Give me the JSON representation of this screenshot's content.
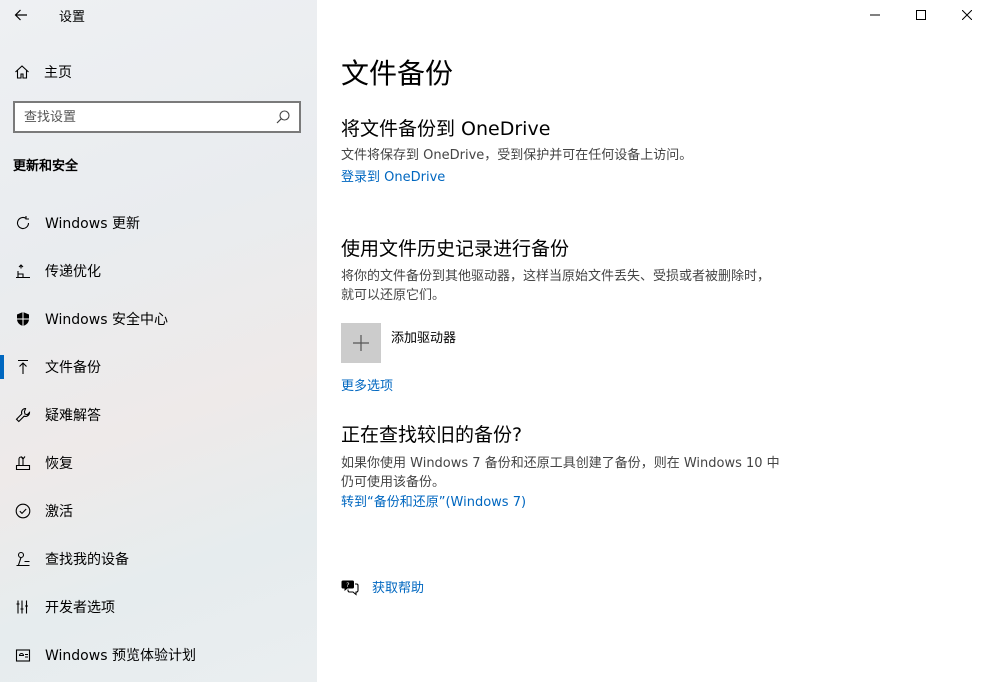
{
  "window": {
    "title": "设置"
  },
  "sidebar": {
    "home_label": "主页",
    "search_placeholder": "查找设置",
    "section_title": "更新和安全",
    "items": [
      {
        "label": "Windows 更新",
        "icon": "refresh-icon"
      },
      {
        "label": "传递优化",
        "icon": "delivery-optimization-icon"
      },
      {
        "label": "Windows 安全中心",
        "icon": "shield-icon"
      },
      {
        "label": "文件备份",
        "icon": "backup-arrow-icon",
        "active": true
      },
      {
        "label": "疑难解答",
        "icon": "wrench-icon"
      },
      {
        "label": "恢复",
        "icon": "recovery-icon"
      },
      {
        "label": "激活",
        "icon": "check-circle-icon"
      },
      {
        "label": "查找我的设备",
        "icon": "find-device-icon"
      },
      {
        "label": "开发者选项",
        "icon": "developer-icon"
      },
      {
        "label": "Windows 预览体验计划",
        "icon": "insider-icon"
      }
    ]
  },
  "main": {
    "title": "文件备份",
    "onedrive": {
      "heading": "将文件备份到 OneDrive",
      "description": "文件将保存到 OneDrive，受到保护并可在任何设备上访问。",
      "link": "登录到 OneDrive"
    },
    "history": {
      "heading": "使用文件历史记录进行备份",
      "description": "将你的文件备份到其他驱动器，这样当原始文件丢失、受损或者被删除时，就可以还原它们。",
      "add_drive_label": "添加驱动器",
      "more_options": "更多选项"
    },
    "older": {
      "heading": "正在查找较旧的备份?",
      "description": "如果你使用 Windows 7 备份和还原工具创建了备份，则在 Windows 10 中仍可使用该备份。",
      "link": "转到“备份和还原”(Windows 7)"
    },
    "help_label": "获取帮助"
  },
  "colors": {
    "accent": "#0067c0",
    "tile": "#cccccc"
  }
}
